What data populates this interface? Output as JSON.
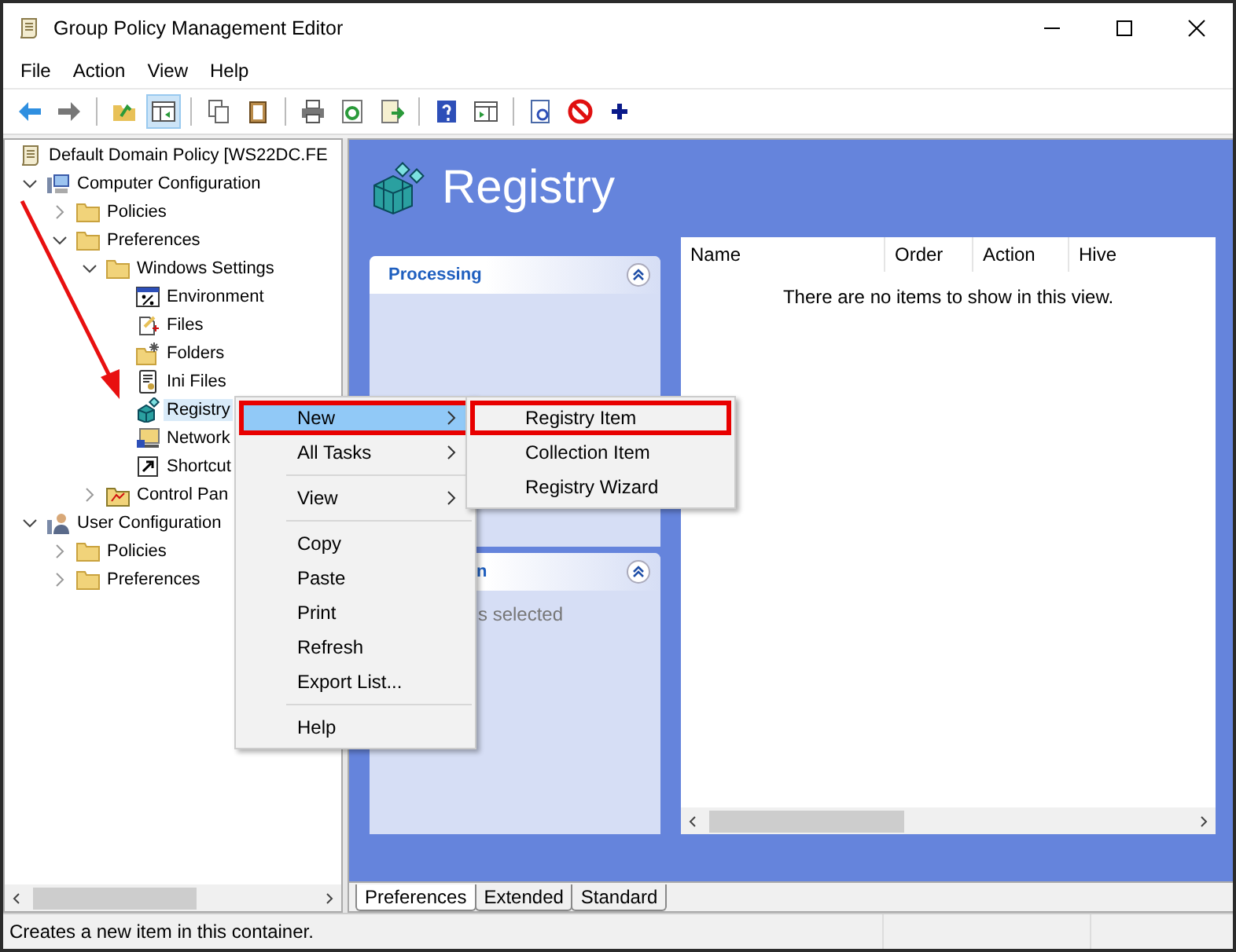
{
  "window": {
    "title": "Group Policy Management Editor"
  },
  "menu_bar": [
    "File",
    "Action",
    "View",
    "Help"
  ],
  "toolbar": [
    {
      "kind": "back",
      "pressed": false
    },
    {
      "kind": "forward",
      "pressed": false
    },
    {
      "kind": "separator"
    },
    {
      "kind": "up-folder",
      "pressed": false
    },
    {
      "kind": "show-tree",
      "pressed": true
    },
    {
      "kind": "separator"
    },
    {
      "kind": "copy",
      "pressed": false
    },
    {
      "kind": "paste",
      "pressed": false
    },
    {
      "kind": "separator"
    },
    {
      "kind": "print",
      "pressed": false
    },
    {
      "kind": "refresh",
      "pressed": false
    },
    {
      "kind": "export",
      "pressed": false
    },
    {
      "kind": "separator"
    },
    {
      "kind": "help",
      "pressed": false
    },
    {
      "kind": "action-pane",
      "pressed": false
    },
    {
      "kind": "separator"
    },
    {
      "kind": "properties",
      "pressed": false
    },
    {
      "kind": "stop",
      "pressed": false
    },
    {
      "kind": "add",
      "pressed": false
    }
  ],
  "tree": {
    "label": "Default Domain Policy [WS22DC.FE",
    "kind": "scroll",
    "selected": false,
    "children": [
      {
        "label": "Computer Configuration",
        "kind": "computer",
        "selected": false,
        "expanded": true,
        "children": [
          {
            "label": "Policies",
            "kind": "folder",
            "selected": false,
            "expanded": false
          },
          {
            "label": "Preferences",
            "kind": "folder",
            "selected": false,
            "expanded": true,
            "children": [
              {
                "label": "Windows Settings",
                "kind": "folder",
                "selected": false,
                "expanded": true,
                "children": [
                  {
                    "label": "Environment",
                    "kind": "environment",
                    "selected": false
                  },
                  {
                    "label": "Files",
                    "kind": "files",
                    "selected": false
                  },
                  {
                    "label": "Folders",
                    "kind": "folders",
                    "selected": false
                  },
                  {
                    "label": "Ini Files",
                    "kind": "ini",
                    "selected": false
                  },
                  {
                    "label": "Registry",
                    "kind": "registry",
                    "selected": true
                  },
                  {
                    "label": "Network",
                    "kind": "network",
                    "selected": false
                  },
                  {
                    "label": "Shortcut",
                    "kind": "shortcut",
                    "selected": false
                  }
                ]
              },
              {
                "label": "Control Pan",
                "kind": "control-panel",
                "selected": false,
                "expanded": false
              }
            ]
          }
        ]
      },
      {
        "label": "User Configuration",
        "kind": "user",
        "selected": false,
        "expanded": true,
        "children": [
          {
            "label": "Policies",
            "kind": "folder",
            "selected": false,
            "expanded": false
          },
          {
            "label": "Preferences",
            "kind": "folder",
            "selected": false,
            "expanded": false
          }
        ]
      }
    ]
  },
  "panel": {
    "title": "Registry"
  },
  "side_cards": [
    {
      "title": "Processing"
    },
    {
      "title": "n",
      "text": "s selected"
    }
  ],
  "list": {
    "columns": [
      "Name",
      "Order",
      "Action",
      "Hive"
    ],
    "empty_message": "There are no items to show in this view."
  },
  "view_tabs": [
    {
      "label": "Preferences",
      "selected": true
    },
    {
      "label": "Extended",
      "selected": false
    },
    {
      "label": "Standard",
      "selected": false
    }
  ],
  "status_bar": {
    "text": "Creates a new item in this container."
  },
  "context_menu": {
    "items": [
      {
        "kind": "item",
        "label": "New",
        "has_submenu": true,
        "highlighted": true,
        "outlined": true
      },
      {
        "kind": "item",
        "label": "All Tasks",
        "has_submenu": true,
        "highlighted": false,
        "outlined": false
      },
      {
        "kind": "separator"
      },
      {
        "kind": "item",
        "label": "View",
        "has_submenu": true,
        "highlighted": false,
        "outlined": false
      },
      {
        "kind": "separator"
      },
      {
        "kind": "item",
        "label": "Copy",
        "has_submenu": false,
        "highlighted": false,
        "outlined": false
      },
      {
        "kind": "item",
        "label": "Paste",
        "has_submenu": false,
        "highlighted": false,
        "outlined": false
      },
      {
        "kind": "item",
        "label": "Print",
        "has_submenu": false,
        "highlighted": false,
        "outlined": false
      },
      {
        "kind": "item",
        "label": "Refresh",
        "has_submenu": false,
        "highlighted": false,
        "outlined": false
      },
      {
        "kind": "item",
        "label": "Export List...",
        "has_submenu": false,
        "highlighted": false,
        "outlined": false
      },
      {
        "kind": "separator"
      },
      {
        "kind": "item",
        "label": "Help",
        "has_submenu": false,
        "highlighted": false,
        "outlined": false
      }
    ]
  },
  "submenu": {
    "items": [
      {
        "label": "Registry Item",
        "outlined": true
      },
      {
        "label": "Collection Item",
        "outlined": false
      },
      {
        "label": "Registry Wizard",
        "outlined": false
      }
    ]
  }
}
